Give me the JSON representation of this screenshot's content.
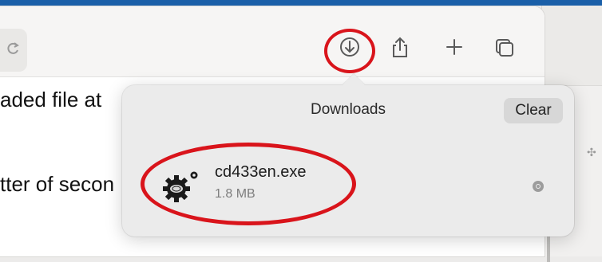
{
  "page": {
    "text_line_1": "aded file at",
    "text_line_2": "tter of secon"
  },
  "toolbar": {
    "icons": [
      "reload-icon",
      "downloads-icon",
      "share-icon",
      "new-tab-icon",
      "tab-overview-icon"
    ]
  },
  "downloads_popover": {
    "title": "Downloads",
    "clear_label": "Clear",
    "items": [
      {
        "name": "cd433en.exe",
        "size": "1.8 MB",
        "icon": "executable-gear-icon"
      }
    ]
  },
  "colors": {
    "annotation_red": "#d9141b",
    "accent_blue": "#1a5fa8"
  }
}
